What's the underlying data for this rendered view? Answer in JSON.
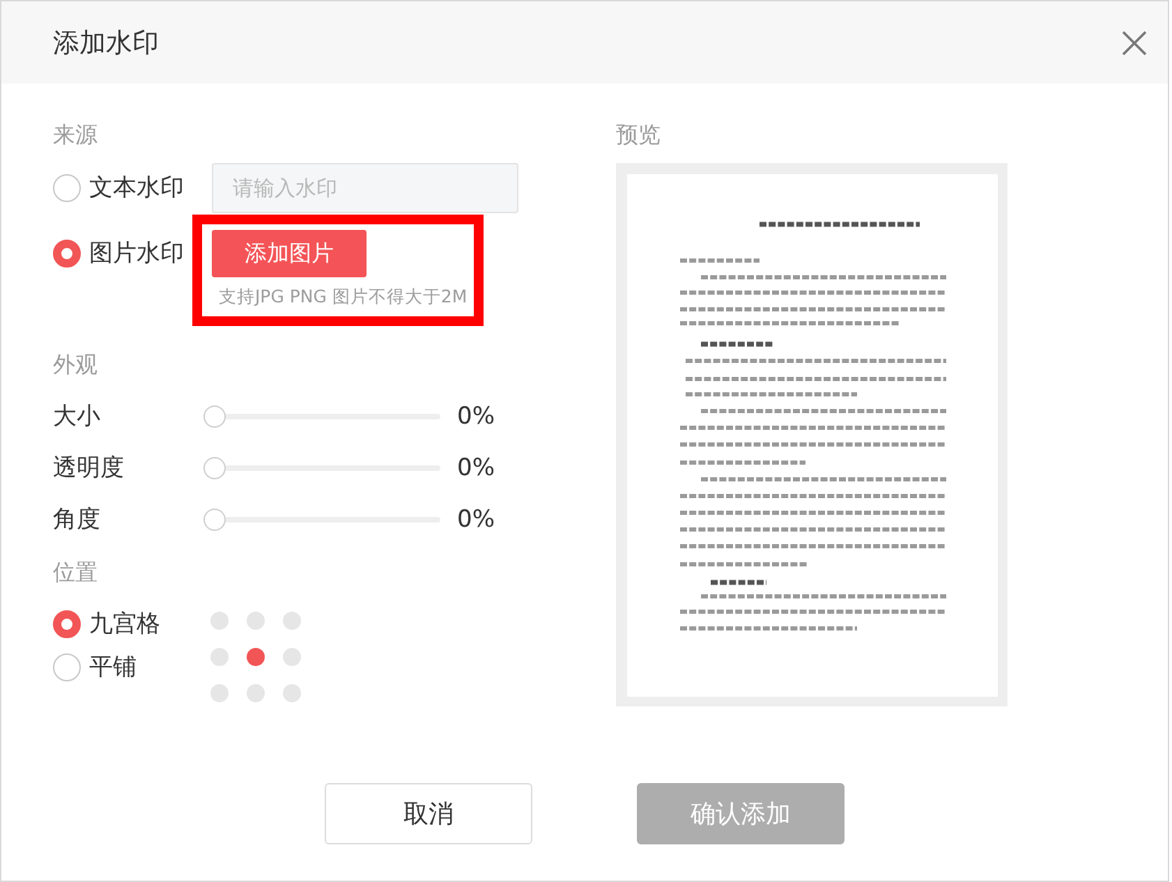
{
  "dialog": {
    "title": "添加水印"
  },
  "source": {
    "label": "来源",
    "options": [
      {
        "kind": "text",
        "label": "文本水印",
        "selected": false,
        "input": {
          "placeholder": "请输入水印"
        }
      },
      {
        "kind": "image",
        "label": "图片水印",
        "selected": true,
        "button": "添加图片",
        "hint": "支持JPG PNG 图片不得大于2M",
        "highlighted": true
      }
    ]
  },
  "appearance": {
    "label": "外观",
    "sliders": [
      {
        "label": "大小",
        "level": 0,
        "reading": "0%"
      },
      {
        "label": "透明度",
        "level": 0,
        "reading": "0%"
      },
      {
        "label": "角度",
        "level": 0,
        "reading": "0%"
      }
    ]
  },
  "position": {
    "label": "位置",
    "modes": [
      {
        "label": "九宫格",
        "selected": true
      },
      {
        "label": "平铺",
        "selected": false
      }
    ],
    "grid": [
      {
        "selected": false
      },
      {
        "selected": false
      },
      {
        "selected": false
      },
      {
        "selected": false
      },
      {
        "selected": true
      },
      {
        "selected": false
      },
      {
        "selected": false
      },
      {
        "selected": false
      },
      {
        "selected": false
      }
    ]
  },
  "preview": {
    "label": "预览"
  },
  "buttons": [
    {
      "kind": "cancel",
      "label": "取消",
      "disabled": false
    },
    {
      "kind": "confirm",
      "label": "确认添加",
      "disabled": true
    }
  ]
}
